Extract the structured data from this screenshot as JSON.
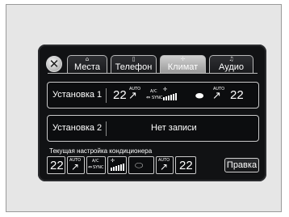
{
  "tabs": [
    {
      "label": "Места",
      "icon": "seat-icon"
    },
    {
      "label": "Телефон",
      "icon": "phone-icon"
    },
    {
      "label": "Климат",
      "icon": "fan-icon"
    },
    {
      "label": "Аудио",
      "icon": "music-note-icon"
    }
  ],
  "active_tab": "Климат",
  "preset1": {
    "label": "Установка 1",
    "driver_temp": "22",
    "passenger_temp": "22",
    "auto_label": "AUTO",
    "ac_label": "A/C",
    "sync_label": "SYNC"
  },
  "preset2": {
    "label": "Установка 2",
    "status": "Нет записи"
  },
  "current": {
    "label": "Текущая настройка кондиционера",
    "driver_temp": "22",
    "passenger_temp": "22",
    "auto_label": "AUTO",
    "ac_label": "A/C",
    "sync_label": "SYNC",
    "edit_label": "Правка"
  }
}
